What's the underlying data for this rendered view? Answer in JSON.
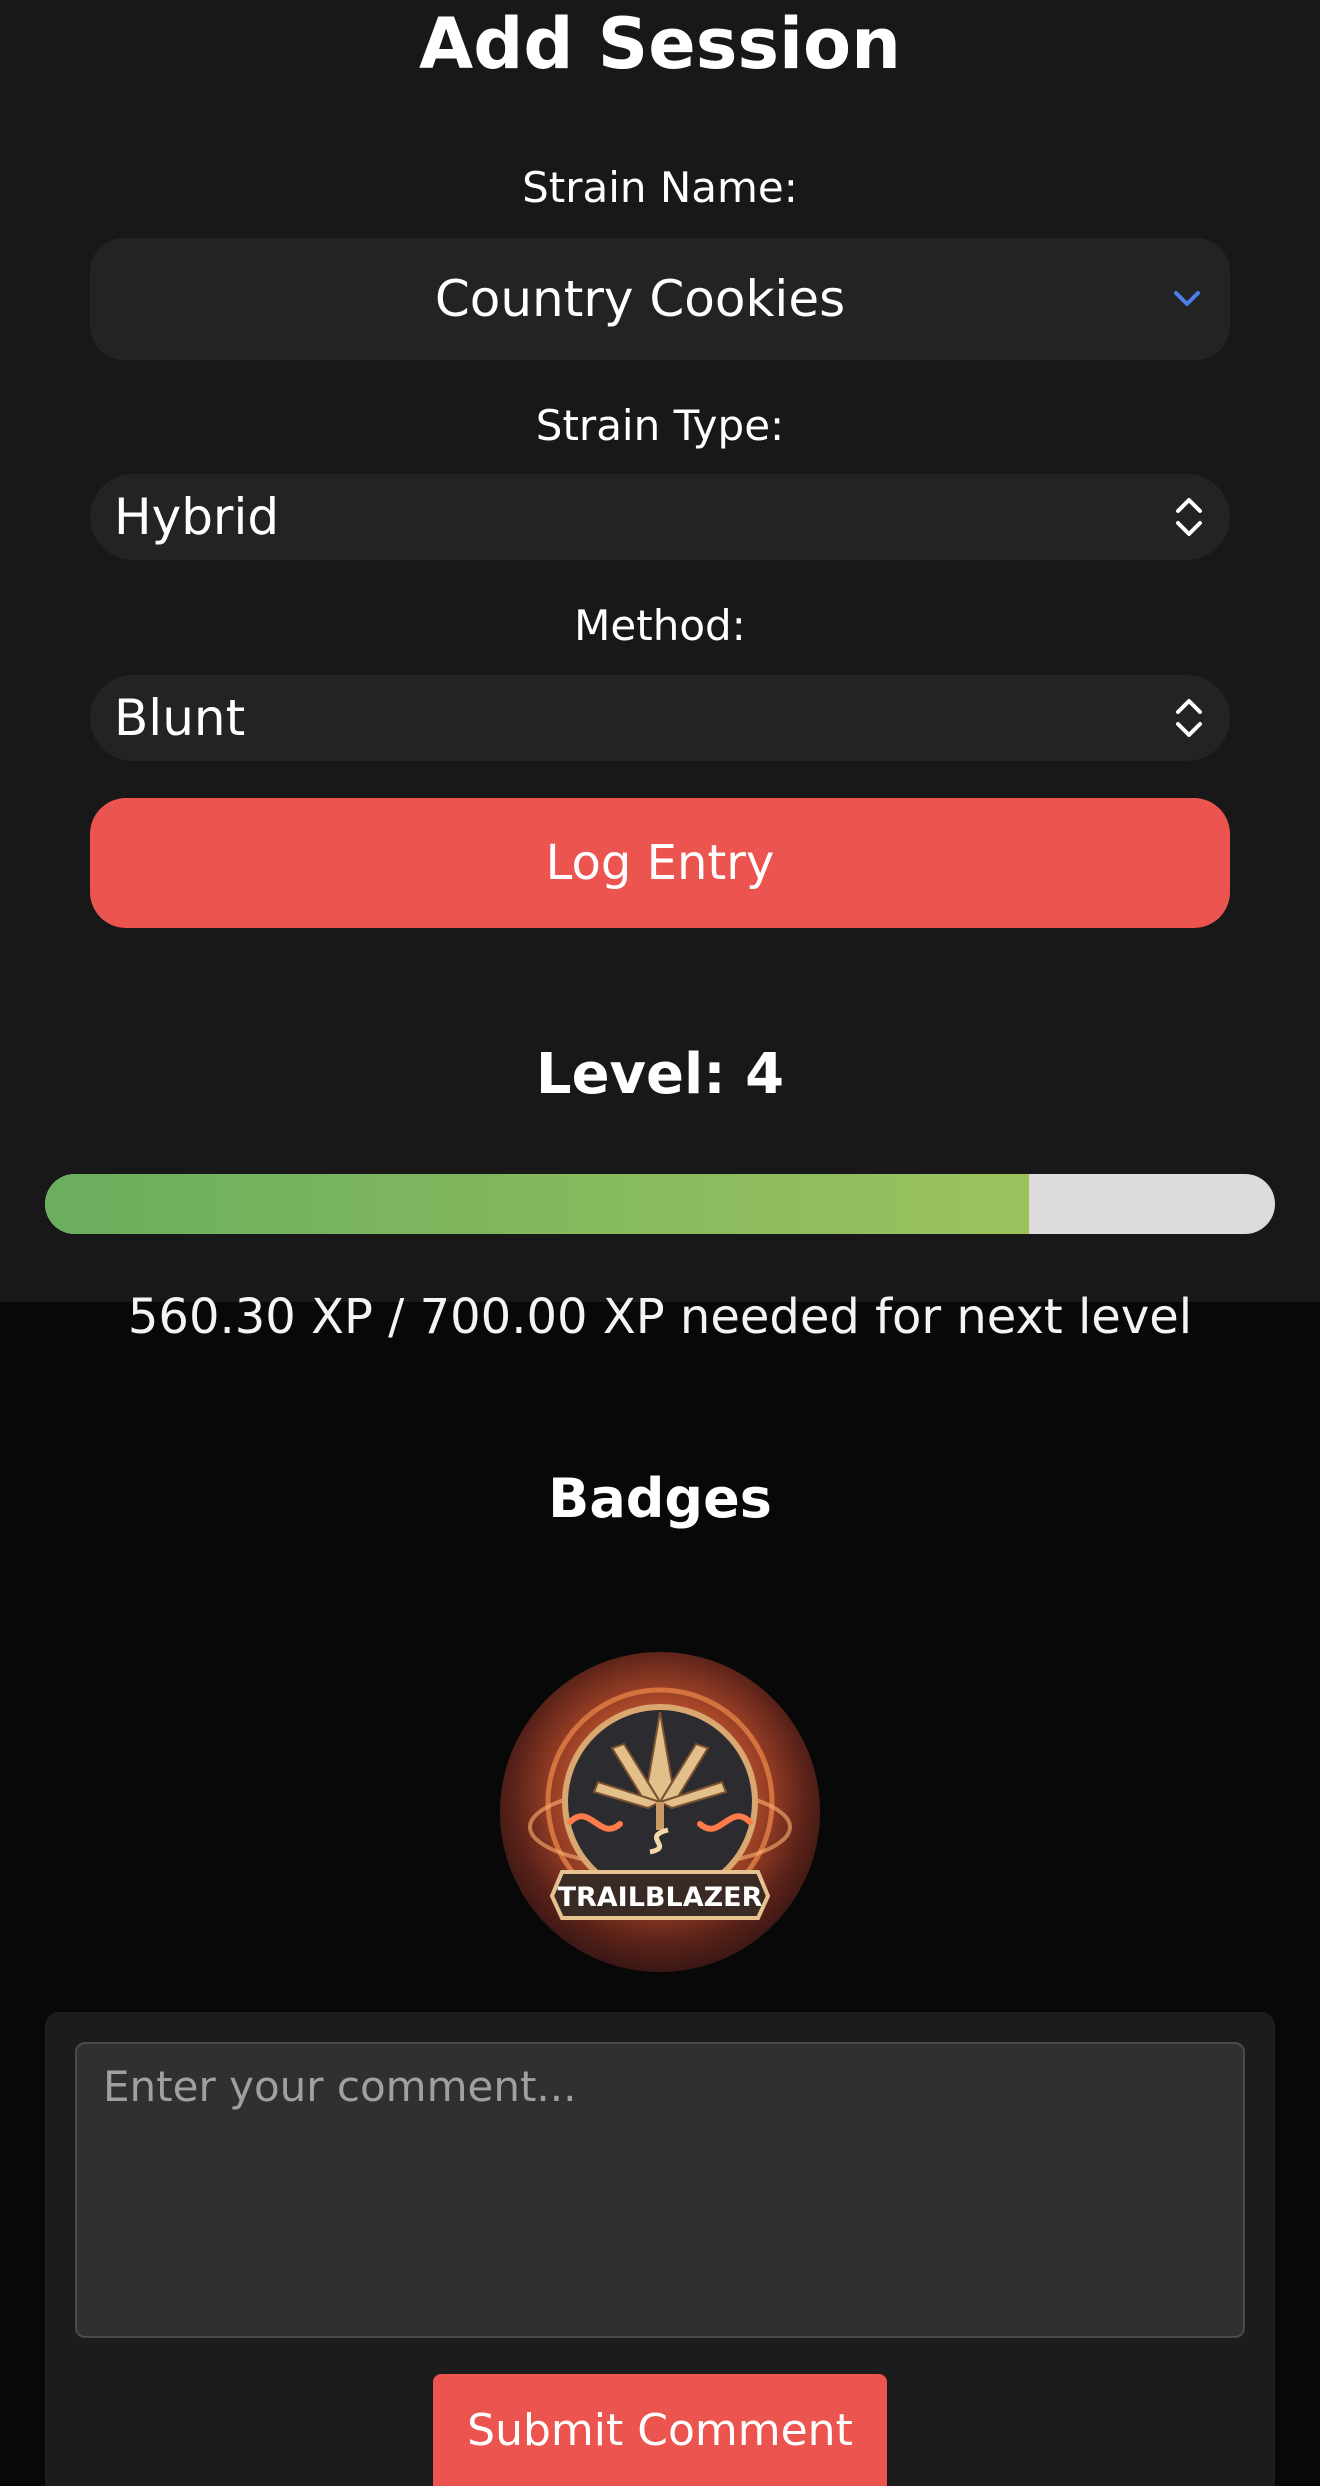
{
  "form": {
    "title": "Add Session",
    "strain_name_label": "Strain Name:",
    "strain_name_value": "Country Cookies",
    "strain_type_label": "Strain Type:",
    "strain_type_value": "Hybrid",
    "method_label": "Method:",
    "method_value": "Blunt",
    "submit_label": "Log Entry"
  },
  "level": {
    "title": "Level: 4",
    "xp_current": 560.3,
    "xp_needed": 700.0,
    "progress_fraction": 0.8004,
    "xp_text": "560.30 XP / 700.00 XP needed for next level"
  },
  "badges": {
    "title": "Badges",
    "items": [
      {
        "name": "TRAILBLAZER",
        "icon": "leaf-badge-icon"
      }
    ]
  },
  "comment": {
    "placeholder": "Enter your comment...",
    "value": "",
    "submit_label": "Submit Comment"
  },
  "colors": {
    "accent": "#ec5450",
    "progress_start": "#6aae5e",
    "progress_end": "#9cc25e",
    "progress_track": "#dcdcdc",
    "chevron_blue": "#4a7fe8"
  }
}
